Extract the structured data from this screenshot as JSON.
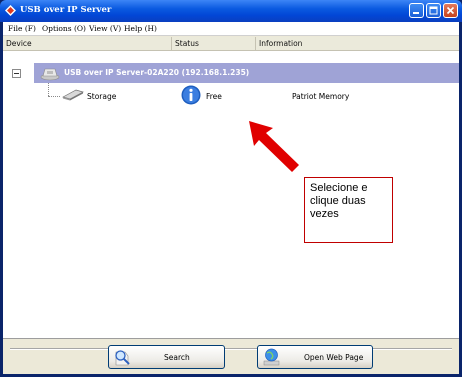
{
  "window": {
    "title": "USB over IP Server"
  },
  "menu": [
    {
      "label": "File (F)"
    },
    {
      "label": "Options (O)"
    },
    {
      "label": "View (V)"
    },
    {
      "label": "Help (H)"
    }
  ],
  "columns": {
    "device": "Device",
    "status": "Status",
    "information": "Information"
  },
  "server_row": {
    "label": "USB over IP Server-02A220 (192.168.1.235)"
  },
  "device_row": {
    "name": "Storage",
    "status": "Free",
    "information": "Patriot Memory"
  },
  "callout": {
    "text": "Selecione e clique duas vezes"
  },
  "buttons": {
    "search": "Search",
    "open_web_page": "Open Web Page"
  },
  "colors": {
    "titlebar": "#0a5ae0",
    "selection": "#9fa3d6",
    "arrow": "#e00000"
  },
  "icons": {
    "title": "usb-server-icon",
    "server": "server-device-icon",
    "storage": "usb-drive-icon",
    "status": "info-icon",
    "search": "magnifier-icon",
    "web": "globe-icon"
  }
}
